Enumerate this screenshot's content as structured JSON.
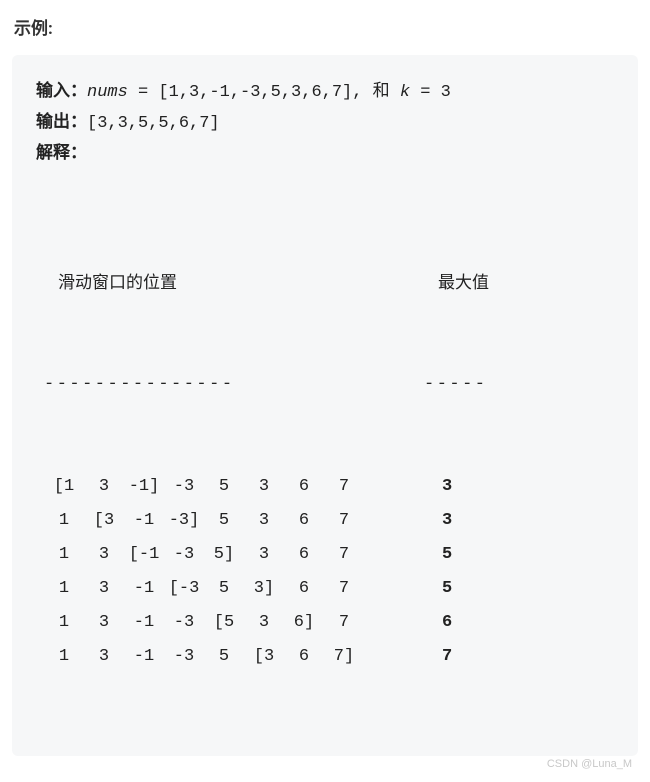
{
  "heading": "示例:",
  "input": {
    "label": "输入：",
    "var_nums": "nums",
    "eq1": " = [1,3,-1,-3,5,3,6,7], 和 ",
    "var_k": "k",
    "eq2": " = 3"
  },
  "output": {
    "label": "输出：",
    "value": "[3,3,5,5,6,7]"
  },
  "explain_label": "解释：",
  "table_headers": {
    "position": "滑动窗口的位置",
    "max": "最大值"
  },
  "dashes": {
    "left": "---------------",
    "right": "-----"
  },
  "nums": [
    1,
    3,
    -1,
    -3,
    5,
    3,
    6,
    7
  ],
  "k": 3,
  "windows": [
    {
      "start": 0,
      "end": 2,
      "max": 3
    },
    {
      "start": 1,
      "end": 3,
      "max": 3
    },
    {
      "start": 2,
      "end": 4,
      "max": 5
    },
    {
      "start": 3,
      "end": 5,
      "max": 5
    },
    {
      "start": 4,
      "end": 6,
      "max": 6
    },
    {
      "start": 5,
      "end": 7,
      "max": 7
    }
  ],
  "watermark": "CSDN @Luna_M"
}
